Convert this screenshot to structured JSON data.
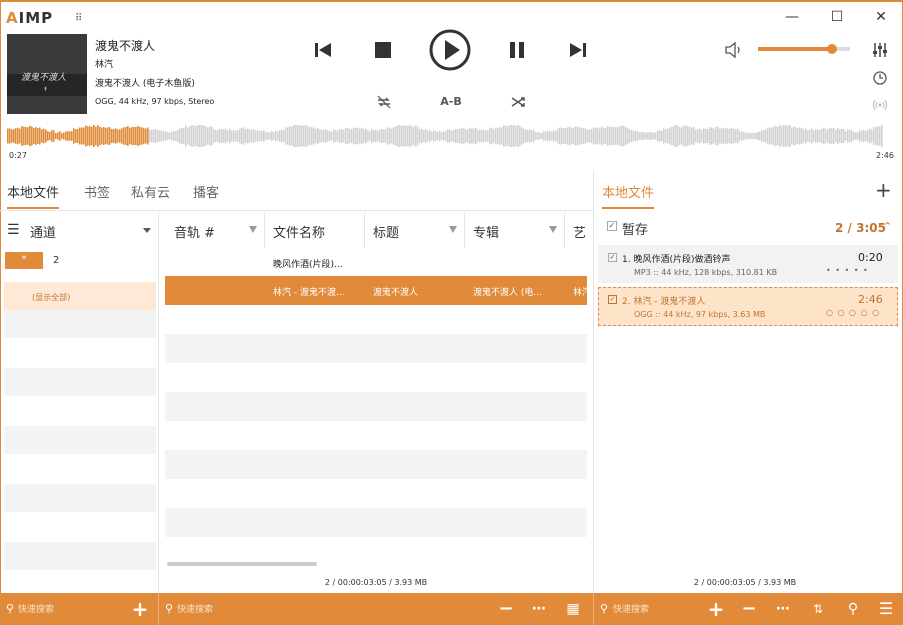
{
  "app": {
    "logo_prefix": "A",
    "logo_rest": "IMP"
  },
  "window": {
    "minimize": "—",
    "maximize": "☐",
    "close": "✕"
  },
  "now_playing": {
    "cover_title": "渡鬼不渡人",
    "title": "渡鬼不渡人",
    "artist": "林汽",
    "album": "渡鬼不渡人 (电子木鱼版)",
    "info": "OGG, 44 kHz, 97 kbps, Stereo"
  },
  "controls": {
    "prev": "prev-icon",
    "stop": "stop-icon",
    "play": "play-icon",
    "pause": "pause-icon",
    "next": "next-icon",
    "repeat": "repeat-icon",
    "ab": "A-B",
    "shuffle": "shuffle-icon",
    "volume_level": 0.8
  },
  "progress": {
    "elapsed": "0:27",
    "total": "2:46",
    "fraction": 0.16
  },
  "left_tabs": [
    "本地文件",
    "书签",
    "私有云",
    "播客"
  ],
  "right_tab": "本地文件",
  "channel": {
    "label": "通道",
    "star": "*",
    "star_count": "2",
    "show_all": "(显示全部)",
    "folder_count": "2"
  },
  "table": {
    "columns": [
      "音轨 #",
      "文件名称",
      "标题",
      "专辑",
      "艺"
    ],
    "rows": [
      {
        "filename": "晚风作酒(片段)...",
        "title": "",
        "album": "",
        "artist": "",
        "selected": false
      },
      {
        "filename": "林汽 - 渡鬼不渡...",
        "title": "渡鬼不渡人",
        "album": "渡鬼不渡人 (电...",
        "artist": "林汽",
        "selected": true
      }
    ],
    "summary": "2 / 00:00:03:05 / 3.93 MB"
  },
  "playlist": {
    "group": "暂存",
    "group_stats": "2 / 3:05",
    "items": [
      {
        "title": "1. 晚风作酒(片段)做酒铃声",
        "duration": "0:20",
        "info": "MP3 :: 44 kHz, 128 kbps, 310.81 KB",
        "dots": "• • • • •",
        "active": false
      },
      {
        "title": "2. 林汽 - 渡鬼不渡人",
        "duration": "2:46",
        "info": "OGG :: 44 kHz, 97 kbps, 3.63 MB",
        "dots": "○ ○ ○ ○ ○",
        "active": true
      }
    ],
    "summary": "2 / 00:00:03:05 / 3.93 MB"
  },
  "search": {
    "placeholder": "快速搜索"
  },
  "colors": {
    "accent": "#e08a3a",
    "selected_row": "#e08a3a",
    "highlight": "#fde3c8"
  }
}
